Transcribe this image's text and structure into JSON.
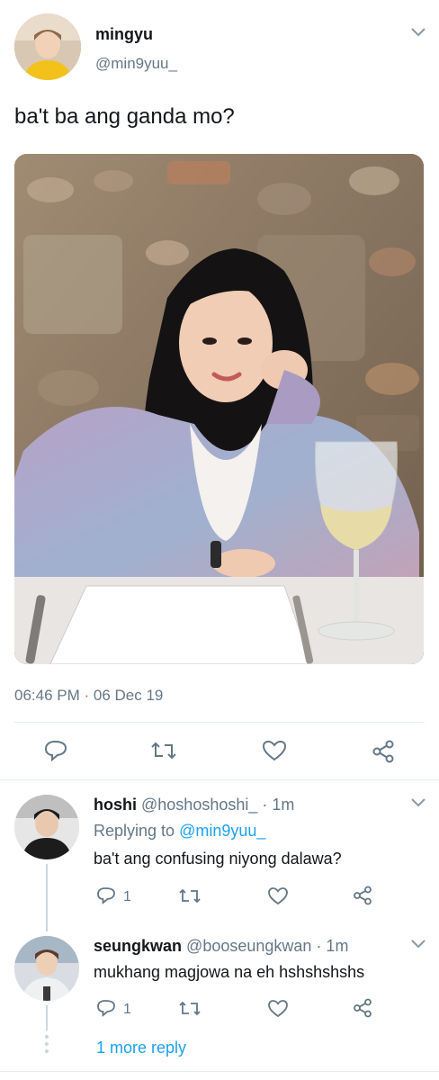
{
  "tweet": {
    "author_name": "mingyu",
    "author_handle": "@min9yuu_",
    "text": "ba't ba ang ganda mo?",
    "time": "06:46 PM · 06 Dec 19",
    "actions": [
      "reply-icon",
      "retweet-icon",
      "like-icon",
      "share-icon"
    ]
  },
  "replies": [
    {
      "name": "hoshi",
      "handle": "@hoshoshoshi_",
      "time": "· 1m",
      "replying_prefix": "Replying to",
      "replying_to": "@min9yuu_",
      "text": "ba't ang confusing niyong dalawa?",
      "reply_count": "1"
    },
    {
      "name": "seungkwan",
      "handle": "@booseungkwan",
      "time": "· 1m",
      "text": "mukhang magjowa na eh hshshshshs",
      "reply_count": "1"
    }
  ],
  "more_replies": "1 more reply",
  "colors": {
    "accent": "#1da1f2",
    "muted": "#657786",
    "border": "#e6ecf0"
  }
}
